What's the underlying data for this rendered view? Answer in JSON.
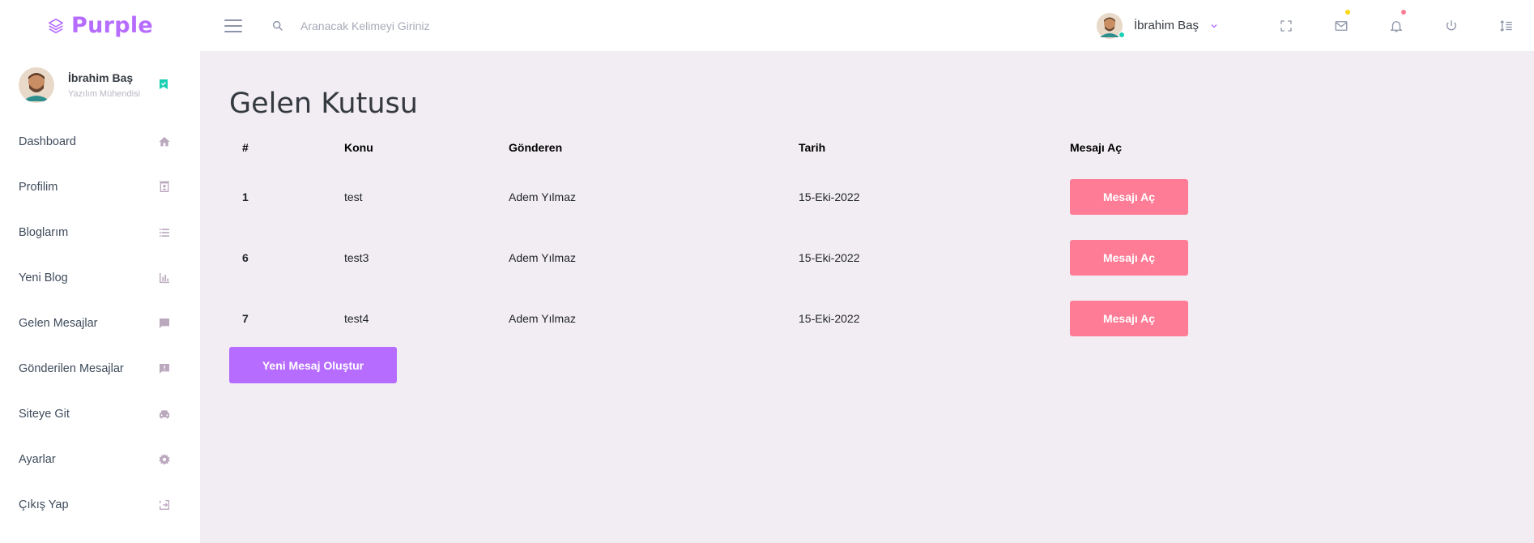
{
  "brand": {
    "name": "Purple",
    "color": "#b66dff",
    "icon": "layers-icon"
  },
  "search": {
    "placeholder": "Aranacak Kelimeyi Giriniz"
  },
  "navbar": {
    "user_name": "İbrahim Baş",
    "icons": [
      "fullscreen-icon",
      "mail-icon",
      "bell-icon",
      "power-icon",
      "list-icon"
    ]
  },
  "sidebar": {
    "user": {
      "name": "İbrahim Baş",
      "role": "Yazılım Mühendisi"
    },
    "items": [
      {
        "label": "Dashboard",
        "icon": "home-icon"
      },
      {
        "label": "Profilim",
        "icon": "contact-icon"
      },
      {
        "label": "Bloglarım",
        "icon": "list-icon"
      },
      {
        "label": "Yeni Blog",
        "icon": "chart-bar-icon"
      },
      {
        "label": "Gelen Mesajlar",
        "icon": "chat-icon"
      },
      {
        "label": "Gönderilen Mesajlar",
        "icon": "chat-alert-icon"
      },
      {
        "label": "Siteye Git",
        "icon": "car-icon"
      },
      {
        "label": "Ayarlar",
        "icon": "gear-icon"
      },
      {
        "label": "Çıkış Yap",
        "icon": "exit-icon"
      }
    ]
  },
  "main": {
    "title": "Gelen Kutusu",
    "table": {
      "headers": [
        "#",
        "Konu",
        "Gönderen",
        "Tarih",
        "Mesajı Aç"
      ],
      "rows": [
        {
          "id": "1",
          "subject": "test",
          "sender": "Adem Yılmaz",
          "date": "15-Eki-2022",
          "action": "Mesajı Aç"
        },
        {
          "id": "6",
          "subject": "test3",
          "sender": "Adem Yılmaz",
          "date": "15-Eki-2022",
          "action": "Mesajı Aç"
        },
        {
          "id": "7",
          "subject": "test4",
          "sender": "Adem Yılmaz",
          "date": "15-Eki-2022",
          "action": "Mesajı Aç"
        }
      ]
    },
    "new_message_label": "Yeni Mesaj Oluştur"
  },
  "colors": {
    "primary": "#b66dff",
    "danger": "#fe7c96",
    "success": "#1bcfb4",
    "warning": "#fed713",
    "background": "#f2edf3"
  }
}
